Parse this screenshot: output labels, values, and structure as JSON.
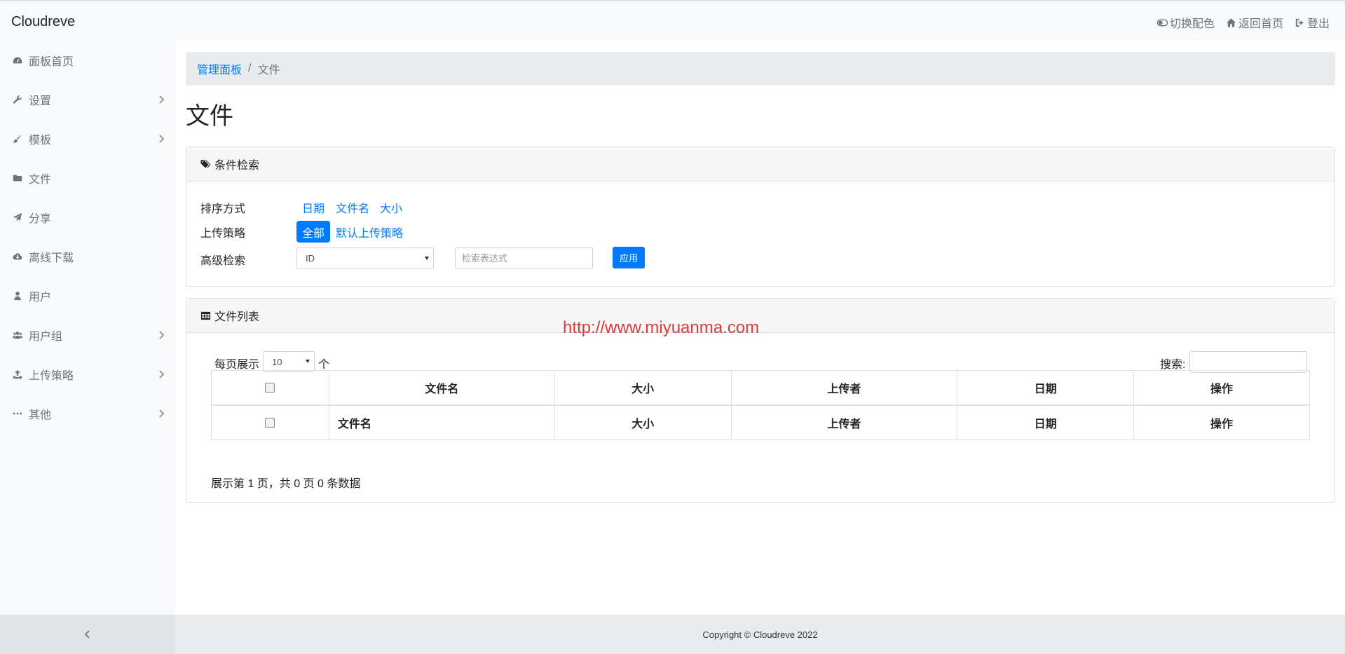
{
  "app": {
    "brand": "Cloudreve"
  },
  "topnav": {
    "toggle_theme": "切换配色",
    "home": "返回首页",
    "logout": "登出"
  },
  "sidebar": {
    "items": [
      {
        "label": "面板首页",
        "icon": "dashboard-icon",
        "has_children": false
      },
      {
        "label": "设置",
        "icon": "wrench-icon",
        "has_children": true
      },
      {
        "label": "模板",
        "icon": "paintbrush-icon",
        "has_children": true
      },
      {
        "label": "文件",
        "icon": "folder-icon",
        "has_children": false
      },
      {
        "label": "分享",
        "icon": "send-icon",
        "has_children": false
      },
      {
        "label": "离线下载",
        "icon": "cloud-download-icon",
        "has_children": false
      },
      {
        "label": "用户",
        "icon": "user-icon",
        "has_children": false
      },
      {
        "label": "用户组",
        "icon": "users-icon",
        "has_children": true
      },
      {
        "label": "上传策略",
        "icon": "upload-icon",
        "has_children": true
      },
      {
        "label": "其他",
        "icon": "ellipsis-icon",
        "has_children": true
      }
    ]
  },
  "breadcrumb": {
    "parent": "管理面板",
    "separator": "/",
    "current": "文件"
  },
  "page": {
    "title": "文件"
  },
  "filter_card": {
    "header": "条件检索",
    "sort_label": "排序方式",
    "sort_options": [
      "日期",
      "文件名",
      "大小"
    ],
    "policy_label": "上传策略",
    "policy_active": "全部",
    "policy_other": "默认上传策略",
    "advanced_label": "高级检索",
    "advanced_field_value": "ID",
    "advanced_placeholder": "检索表达式",
    "apply_label": "应用"
  },
  "watermark": "http://www.miyuanma.com",
  "list_card": {
    "header": "文件列表",
    "per_page_prefix": "每页展示",
    "per_page_value": "10",
    "per_page_suffix": "个",
    "search_label": "搜索:",
    "columns": [
      "文件名",
      "大小",
      "上传者",
      "日期",
      "操作"
    ],
    "footer_columns": [
      "文件名",
      "大小",
      "上传者",
      "日期",
      "操作"
    ],
    "summary": "展示第 1 页，共 0 页 0 条数据"
  },
  "footer": {
    "copyright": "Copyright © Cloudreve 2022"
  },
  "colors": {
    "accent": "#007bff",
    "watermark": "#e03b3b",
    "sidebar_bg": "#f8f9fa"
  }
}
